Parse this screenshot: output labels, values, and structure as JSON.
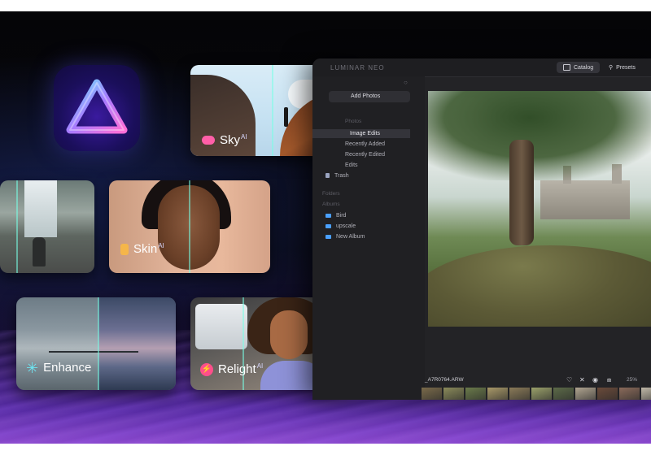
{
  "features": {
    "sky": {
      "label": "Sky",
      "ai": "AI"
    },
    "skin": {
      "label": "Skin",
      "ai": "AI"
    },
    "enhance": {
      "label": "Enhance"
    },
    "relight": {
      "label": "Relight",
      "ai": "AI"
    }
  },
  "app": {
    "brand": "LUMINAR NEO",
    "tabs": [
      "Catalog",
      "Presets"
    ],
    "sidebar": {
      "add_photos": "Add Photos",
      "photos_header": "Photos",
      "items": [
        "Image Edits",
        "Recently Added",
        "Recently Edited",
        "Edits",
        "Trash"
      ],
      "folders_header": "Folders",
      "albums_header": "Albums",
      "albums": [
        "Bird",
        "upscale",
        "New Album"
      ]
    },
    "viewer": {
      "filename": "_A7R0764.ARW",
      "zoom": "25%"
    }
  },
  "colors": {
    "accent": "#4aa0ff",
    "sky_badge": "#ff5fa8",
    "skin_badge": "#f5b64a",
    "enhance_badge": "#6fe3f0",
    "relight_badge": "#ff4f8a"
  },
  "icons": {
    "app": "luminar-triangle-icon",
    "heart": "heart-icon",
    "reject": "close-icon",
    "eye": "eye-icon",
    "compare": "compare-icon"
  },
  "thumb_colors": [
    "#7a6a4a",
    "#8a8a5a",
    "#6a7a4a",
    "#a89868",
    "#8a7a58",
    "#9aa06a",
    "#5c6a48",
    "#b0a490",
    "#6a4a3a",
    "#8a6a5a",
    "#c0b8a8",
    "#4a5a48",
    "#9a8a78",
    "#7a7060",
    "#6a6050",
    "#a09080"
  ]
}
